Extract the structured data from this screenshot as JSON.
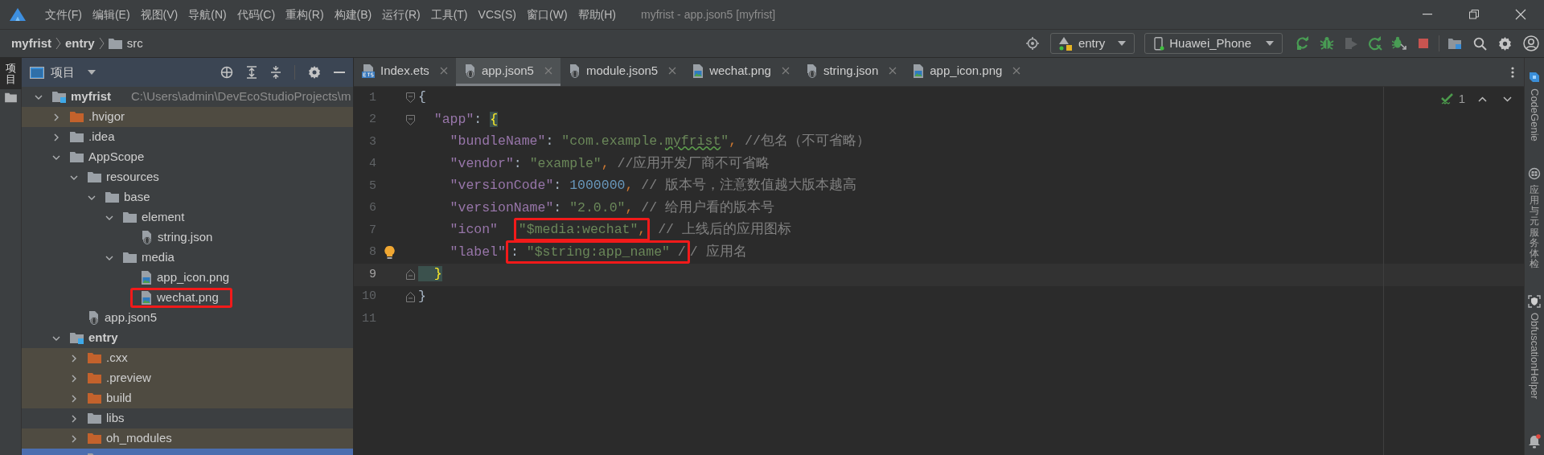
{
  "window": {
    "title": "myfrist - app.json5 [myfrist]"
  },
  "menu": [
    "文件(F)",
    "编辑(E)",
    "视图(V)",
    "导航(N)",
    "代码(C)",
    "重构(R)",
    "构建(B)",
    "运行(R)",
    "工具(T)",
    "VCS(S)",
    "窗口(W)",
    "帮助(H)"
  ],
  "breadcrumb": [
    {
      "label": "myfrist",
      "kind": "module"
    },
    {
      "label": "entry",
      "kind": "module"
    },
    {
      "label": "src",
      "kind": "folder"
    }
  ],
  "toolbar": {
    "module": "entry",
    "device": "Huawei_Phone",
    "actions": [
      {
        "kind": "run",
        "disabled": false
      },
      {
        "kind": "debug",
        "disabled": false
      },
      {
        "kind": "profile",
        "disabled": true
      },
      {
        "kind": "rerun",
        "disabled": false
      },
      {
        "kind": "attach",
        "disabled": false
      },
      {
        "kind": "stop",
        "disabled": false
      }
    ]
  },
  "left_strip": [
    {
      "label": "项目",
      "selected": true
    }
  ],
  "project_panel": {
    "title": "项目",
    "tree": [
      {
        "label": "myfrist",
        "kind": "module",
        "path": "C:\\Users\\admin\\DevEcoStudioProjects\\m",
        "expanded": true,
        "excluded": false,
        "selected": false,
        "highlighted": false,
        "children": [
          {
            "label": ".hvigor",
            "kind": "folder",
            "expanded": false,
            "excluded": true,
            "selected": false,
            "highlighted": false
          },
          {
            "label": ".idea",
            "kind": "folder",
            "expanded": false,
            "excluded": false,
            "selected": false,
            "highlighted": false
          },
          {
            "label": "AppScope",
            "kind": "folder",
            "expanded": true,
            "excluded": false,
            "selected": false,
            "highlighted": false,
            "children": [
              {
                "label": "resources",
                "kind": "folder",
                "expanded": true,
                "excluded": false,
                "selected": false,
                "highlighted": false,
                "children": [
                  {
                    "label": "base",
                    "kind": "folder",
                    "expanded": true,
                    "excluded": false,
                    "selected": false,
                    "highlighted": false,
                    "children": [
                      {
                        "label": "element",
                        "kind": "folder",
                        "expanded": true,
                        "excluded": false,
                        "selected": false,
                        "highlighted": false,
                        "children": [
                          {
                            "label": "string.json",
                            "kind": "json",
                            "excluded": false,
                            "selected": false,
                            "highlighted": false
                          }
                        ]
                      },
                      {
                        "label": "media",
                        "kind": "folder",
                        "expanded": true,
                        "excluded": false,
                        "selected": false,
                        "highlighted": false,
                        "children": [
                          {
                            "label": "app_icon.png",
                            "kind": "image",
                            "excluded": false,
                            "selected": false,
                            "highlighted": false
                          },
                          {
                            "label": "wechat.png",
                            "kind": "image",
                            "excluded": false,
                            "selected": false,
                            "highlighted": true
                          }
                        ]
                      }
                    ]
                  }
                ]
              },
              {
                "label": "app.json5",
                "kind": "json",
                "excluded": false,
                "selected": false,
                "highlighted": false
              }
            ]
          },
          {
            "label": "entry",
            "kind": "module",
            "expanded": true,
            "excluded": false,
            "selected": false,
            "highlighted": false,
            "children": [
              {
                "label": ".cxx",
                "kind": "folder",
                "expanded": false,
                "excluded": true,
                "selected": false,
                "highlighted": false
              },
              {
                "label": ".preview",
                "kind": "folder",
                "expanded": false,
                "excluded": true,
                "selected": false,
                "highlighted": false
              },
              {
                "label": "build",
                "kind": "folder",
                "expanded": false,
                "excluded": true,
                "selected": false,
                "highlighted": false
              },
              {
                "label": "libs",
                "kind": "folder",
                "expanded": false,
                "excluded": false,
                "selected": false,
                "highlighted": false
              },
              {
                "label": "oh_modules",
                "kind": "folder",
                "expanded": false,
                "excluded": true,
                "selected": false,
                "highlighted": false
              },
              {
                "kind": "folder",
                "excluded": false,
                "selected": true,
                "highlighted": false
              }
            ]
          }
        ]
      }
    ]
  },
  "tabs": [
    {
      "label": "Index.ets",
      "kind": "ets",
      "selected": false
    },
    {
      "label": "app.json5",
      "kind": "json",
      "selected": true
    },
    {
      "label": "module.json5",
      "kind": "json",
      "selected": false
    },
    {
      "label": "wechat.png",
      "kind": "image",
      "selected": false
    },
    {
      "label": "string.json",
      "kind": "json",
      "selected": false
    },
    {
      "label": "app_icon.png",
      "kind": "image",
      "selected": false
    }
  ],
  "editor": {
    "inspections": "1",
    "lines": [
      {
        "number": "1",
        "kind": "fold_start",
        "current": false,
        "bulb": false,
        "tokens": [
          {
            "text": "{",
            "kind": "brace"
          }
        ]
      },
      {
        "number": "2",
        "kind": "fold_start",
        "current": false,
        "bulb": false,
        "tokens": [
          {
            "text": "  \"app\"",
            "kind": "key"
          },
          {
            "text": ": ",
            "kind": "punct"
          },
          {
            "text": "{",
            "kind": "brace_match"
          }
        ]
      },
      {
        "number": "3",
        "kind": "plain",
        "current": false,
        "bulb": false,
        "tokens": [
          {
            "text": "    \"bundleName\"",
            "kind": "key"
          },
          {
            "text": ": ",
            "kind": "punct"
          },
          {
            "text": "\"com.example.",
            "kind": "string"
          },
          {
            "text": "myfrist",
            "kind": "string",
            "typo": true
          },
          {
            "text": "\"",
            "kind": "string"
          },
          {
            "text": ", ",
            "kind": "comma"
          },
          {
            "text": "//包名（不可省略）",
            "kind": "comment"
          }
        ]
      },
      {
        "number": "4",
        "kind": "plain",
        "current": false,
        "bulb": false,
        "tokens": [
          {
            "text": "    \"vendor\"",
            "kind": "key"
          },
          {
            "text": ": ",
            "kind": "punct"
          },
          {
            "text": "\"example\"",
            "kind": "string"
          },
          {
            "text": ", ",
            "kind": "comma"
          },
          {
            "text": "//应用开发厂商不可省略",
            "kind": "comment"
          }
        ]
      },
      {
        "number": "5",
        "kind": "plain",
        "current": false,
        "bulb": false,
        "tokens": [
          {
            "text": "    \"versionCode\"",
            "kind": "key"
          },
          {
            "text": ": ",
            "kind": "punct"
          },
          {
            "text": "1000000",
            "kind": "number"
          },
          {
            "text": ", ",
            "kind": "comma"
          },
          {
            "text": "// 版本号，注意数值越大版本越高",
            "kind": "comment"
          }
        ]
      },
      {
        "number": "6",
        "kind": "plain",
        "current": false,
        "bulb": false,
        "tokens": [
          {
            "text": "    \"versionName\"",
            "kind": "key"
          },
          {
            "text": ": ",
            "kind": "punct"
          },
          {
            "text": "\"2.0.0\"",
            "kind": "string"
          },
          {
            "text": ", ",
            "kind": "comma"
          },
          {
            "text": "// 给用户看的版本号",
            "kind": "comment"
          }
        ]
      },
      {
        "number": "7",
        "kind": "plain",
        "current": false,
        "bulb": false,
        "tokens": [
          {
            "text": "    \"icon\"  ",
            "kind": "key"
          },
          {
            "text": "\"$media:wechat\"",
            "kind": "string",
            "boxed": true
          },
          {
            "text": ",",
            "kind": "comma",
            "boxed": true
          },
          {
            "text": " // 上线后的应用图标",
            "kind": "comment"
          }
        ]
      },
      {
        "number": "8",
        "kind": "plain",
        "current": false,
        "bulb": true,
        "tokens": [
          {
            "text": "    \"label\"",
            "kind": "key"
          },
          {
            "text": ": ",
            "kind": "punct",
            "boxed": true
          },
          {
            "text": "\"$string:app_name\"",
            "kind": "string",
            "boxed": true
          },
          {
            "text": " /",
            "kind": "comment",
            "boxed": true
          },
          {
            "text": "/ 应用名",
            "kind": "comment"
          }
        ]
      },
      {
        "number": "9",
        "kind": "fold_end",
        "current": true,
        "bulb": false,
        "tokens": [
          {
            "text": "  }",
            "kind": "brace_match"
          }
        ]
      },
      {
        "number": "10",
        "kind": "fold_end",
        "current": false,
        "bulb": false,
        "tokens": [
          {
            "text": "}",
            "kind": "brace"
          }
        ]
      },
      {
        "number": "11",
        "kind": "plain",
        "current": false,
        "bulb": false
      }
    ]
  },
  "right_strip": [
    {
      "label": "CodeGenie",
      "kind": "genie"
    },
    {
      "label": "应用与元服务体检",
      "kind": "robot"
    },
    {
      "label": "ObfuscationHelper",
      "kind": "shield"
    }
  ]
}
